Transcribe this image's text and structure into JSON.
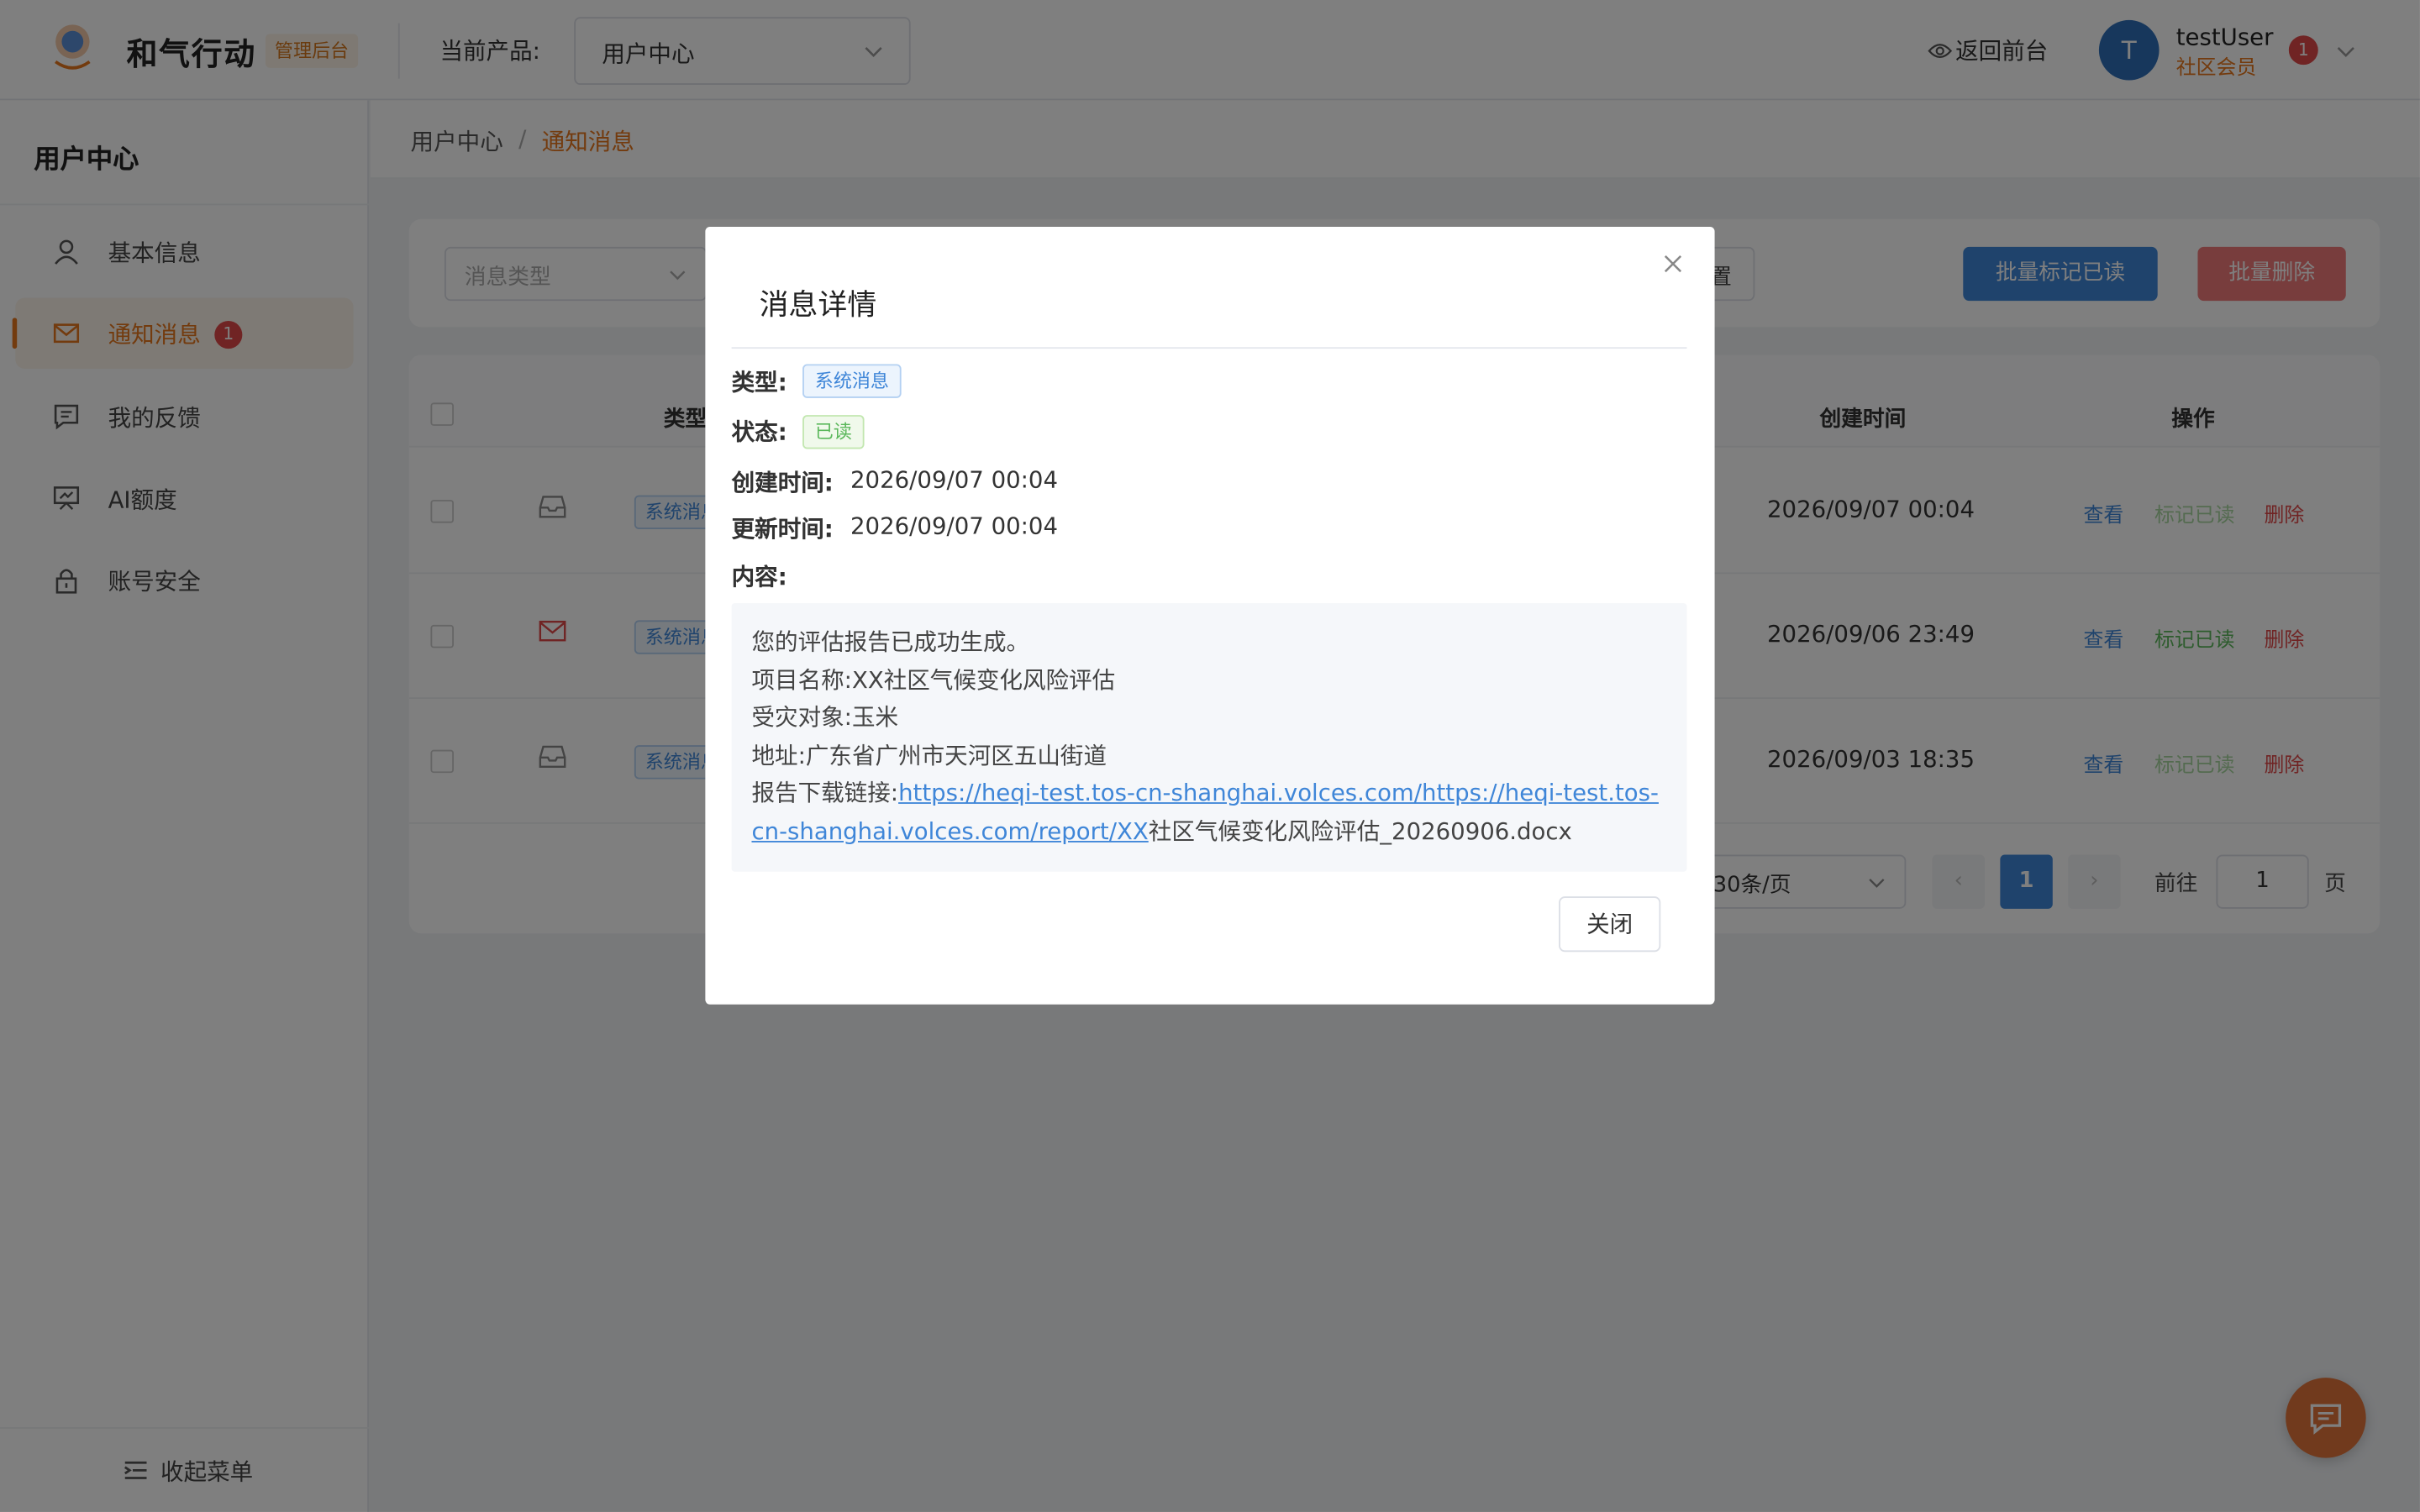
{
  "header": {
    "brand": "和气行动",
    "brand_badge": "管理后台",
    "product_label": "当前产品:",
    "product_value": "用户中心",
    "back_link": "返回前台",
    "user": {
      "avatar_letter": "T",
      "name": "testUser",
      "role": "社区会员",
      "badge": "1"
    }
  },
  "sidebar": {
    "title": "用户中心",
    "items": [
      {
        "label": "基本信息",
        "icon": "user-icon"
      },
      {
        "label": "通知消息",
        "icon": "mail-icon",
        "badge": "1",
        "active": true
      },
      {
        "label": "我的反馈",
        "icon": "feedback-icon"
      },
      {
        "label": "AI额度",
        "icon": "ai-quota-icon"
      },
      {
        "label": "账号安全",
        "icon": "lock-icon"
      }
    ],
    "collapse_label": "收起菜单"
  },
  "breadcrumb": {
    "root": "用户中心",
    "separator": "/",
    "current": "通知消息"
  },
  "filters": {
    "type_placeholder": "消息类型",
    "reset_fragment": "置",
    "batch_read": "批量标记已读",
    "batch_delete": "批量删除"
  },
  "table": {
    "headers": {
      "type": "类型",
      "created": "创建时间",
      "actions": "操作"
    },
    "rows": [
      {
        "tag": "系统消息",
        "created": "2026/09/07 00:04",
        "icon": "inbox-open-icon",
        "read": true
      },
      {
        "tag": "系统消息",
        "created": "2026/09/06 23:49",
        "icon": "mail-unread-icon",
        "read": false
      },
      {
        "tag": "系统消息",
        "created": "2026/09/03 18:35",
        "icon": "inbox-open-icon",
        "read": true
      }
    ],
    "actions": {
      "view": "查看",
      "mark_read": "标记已读",
      "delete": "删除"
    }
  },
  "pagination": {
    "page_size": "30条/页",
    "prev": "‹",
    "current": "1",
    "next": "›",
    "goto_label": "前往",
    "goto_value": "1",
    "page_suffix": "页"
  },
  "modal": {
    "title": "消息详情",
    "type_label": "类型:",
    "type_value": "系统消息",
    "status_label": "状态:",
    "status_value": "已读",
    "created_label": "创建时间:",
    "created_value": "2026/09/07 00:04",
    "updated_label": "更新时间:",
    "updated_value": "2026/09/07 00:04",
    "content_label": "内容:",
    "content": {
      "line1": "您的评估报告已成功生成。",
      "line2": "项目名称:XX社区气候变化风险评估",
      "line3": "受灾对象:玉米",
      "line4": "地址:广东省广州市天河区五山街道",
      "link_label": "报告下载链接:",
      "link_text": "https://heqi-test.tos-cn-shanghai.volces.com/https://heqi-test.tos-cn-shanghai.volces.com/report/XX",
      "link_suffix": "社区气候变化风险评估_20260906.docx"
    },
    "close_button": "关闭"
  },
  "colors": {
    "accent": "#e6761d",
    "primary": "#3f86d8",
    "danger": "#e04848",
    "success": "#5cb85c"
  }
}
